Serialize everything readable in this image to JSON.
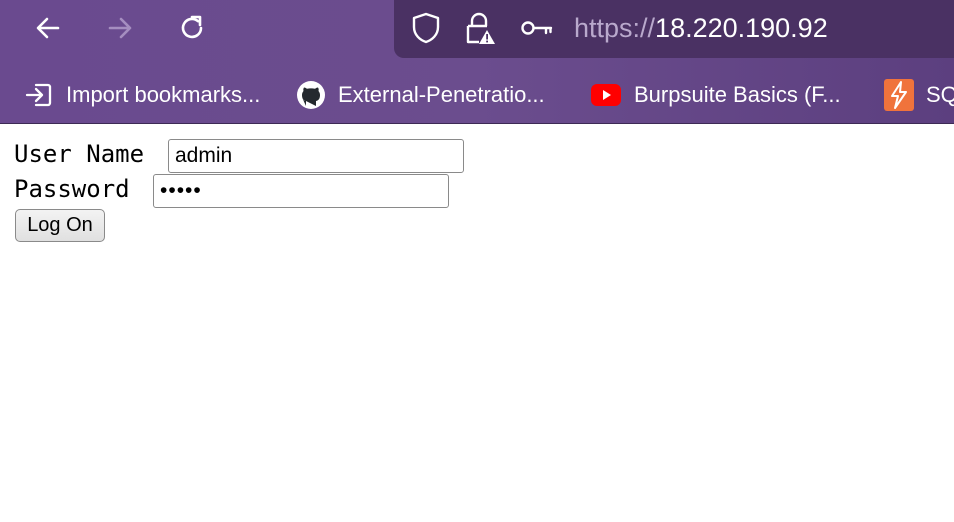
{
  "browser": {
    "nav": {
      "back": "back-arrow-icon",
      "forward": "forward-arrow-icon",
      "reload": "reload-icon"
    },
    "url": {
      "scheme": "https://",
      "host": "18.220.190.92"
    },
    "bookmarks": [
      {
        "label": "Import bookmarks...",
        "icon": "import-icon"
      },
      {
        "label": "External-Penetratio...",
        "icon": "github-icon"
      },
      {
        "label": "Burpsuite Basics (F...",
        "icon": "youtube-icon"
      },
      {
        "label": "SQ",
        "icon": "bolt-icon"
      }
    ]
  },
  "login": {
    "username_label": "User Name",
    "username_value": "admin",
    "password_label": "Password",
    "password_value": "•••••",
    "submit_label": "Log On"
  },
  "colors": {
    "toolbar": "#6a4a8f",
    "urlbar": "#4a3163",
    "youtube": "#ff0000",
    "bolt": "#f0733c"
  }
}
